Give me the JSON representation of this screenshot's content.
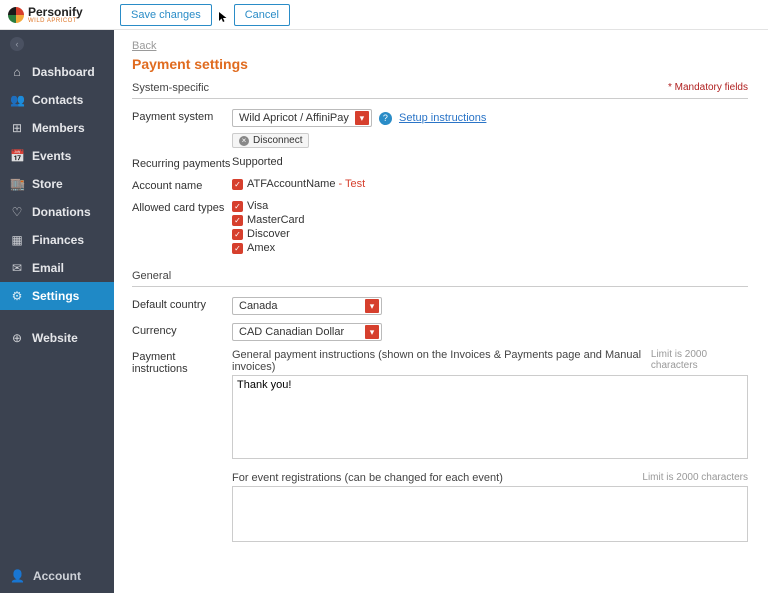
{
  "brand": {
    "name": "Personify",
    "subtitle": "WILD APRICOT"
  },
  "topbar": {
    "save": "Save changes",
    "cancel": "Cancel"
  },
  "sidebar": {
    "items": [
      {
        "icon": "⌂",
        "label": "Dashboard"
      },
      {
        "icon": "👥",
        "label": "Contacts"
      },
      {
        "icon": "⊞",
        "label": "Members"
      },
      {
        "icon": "📅",
        "label": "Events"
      },
      {
        "icon": "🏬",
        "label": "Store"
      },
      {
        "icon": "♡",
        "label": "Donations"
      },
      {
        "icon": "▦",
        "label": "Finances"
      },
      {
        "icon": "✉",
        "label": "Email"
      },
      {
        "icon": "⚙",
        "label": "Settings"
      },
      {
        "icon": "⊕",
        "label": "Website"
      }
    ],
    "footer": {
      "icon": "👤",
      "label": "Account"
    }
  },
  "content": {
    "back": "Back",
    "title": "Payment settings",
    "section1": "System-specific",
    "mandatory": "Mandatory fields",
    "payment_system": {
      "label": "Payment system",
      "value": "Wild Apricot / AffiniPay",
      "setup_link": "Setup instructions",
      "disconnect": "Disconnect"
    },
    "recurring": {
      "label": "Recurring payments",
      "value": "Supported"
    },
    "account_name": {
      "label": "Account name",
      "value": "ATFAccountName",
      "suffix": " - Test"
    },
    "allowed_cards": {
      "label": "Allowed card types",
      "items": [
        "Visa",
        "MasterCard",
        "Discover",
        "Amex"
      ]
    },
    "section2": "General",
    "default_country": {
      "label": "Default country",
      "value": "Canada"
    },
    "currency": {
      "label": "Currency",
      "value": "CAD Canadian Dollar"
    },
    "payment_instructions": {
      "label": "Payment instructions",
      "head1": "General payment instructions (shown on the Invoices & Payments page and Manual invoices)",
      "limit1": "Limit is 2000 characters",
      "value1": "Thank you!",
      "head2": "For event registrations (can be changed for each event)",
      "limit2": "Limit is 2000 characters",
      "value2": ""
    }
  }
}
